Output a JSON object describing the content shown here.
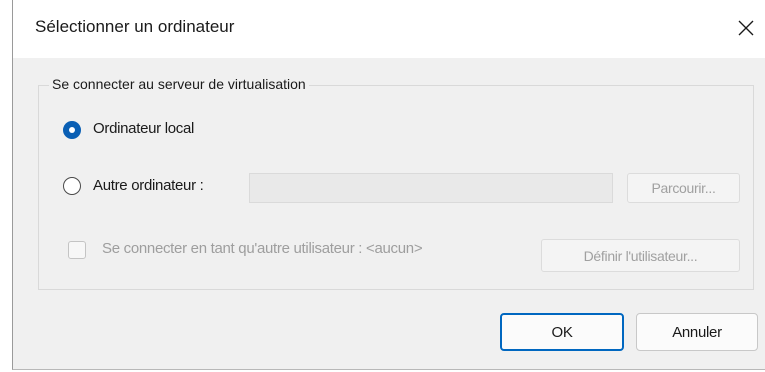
{
  "window": {
    "title": "Sélectionner un ordinateur",
    "close_icon": "close-icon"
  },
  "group": {
    "label": "Se connecter au serveur de virtualisation",
    "local_option": {
      "label": "Ordinateur local",
      "checked": true
    },
    "other_option": {
      "label": "Autre ordinateur :",
      "checked": false,
      "computer_name_value": "",
      "browse_label": "Parcourir..."
    },
    "other_user": {
      "label": "Se connecter en tant qu'autre utilisateur : <aucun>",
      "checked": false,
      "set_user_label": "Définir l'utilisateur..."
    }
  },
  "footer": {
    "ok_label": "OK",
    "cancel_label": "Annuler"
  },
  "colors": {
    "accent": "#0067c0",
    "dialog_bg": "#f0f0f0",
    "titlebar_bg": "#ffffff",
    "disabled_text": "#9e9e9e"
  }
}
